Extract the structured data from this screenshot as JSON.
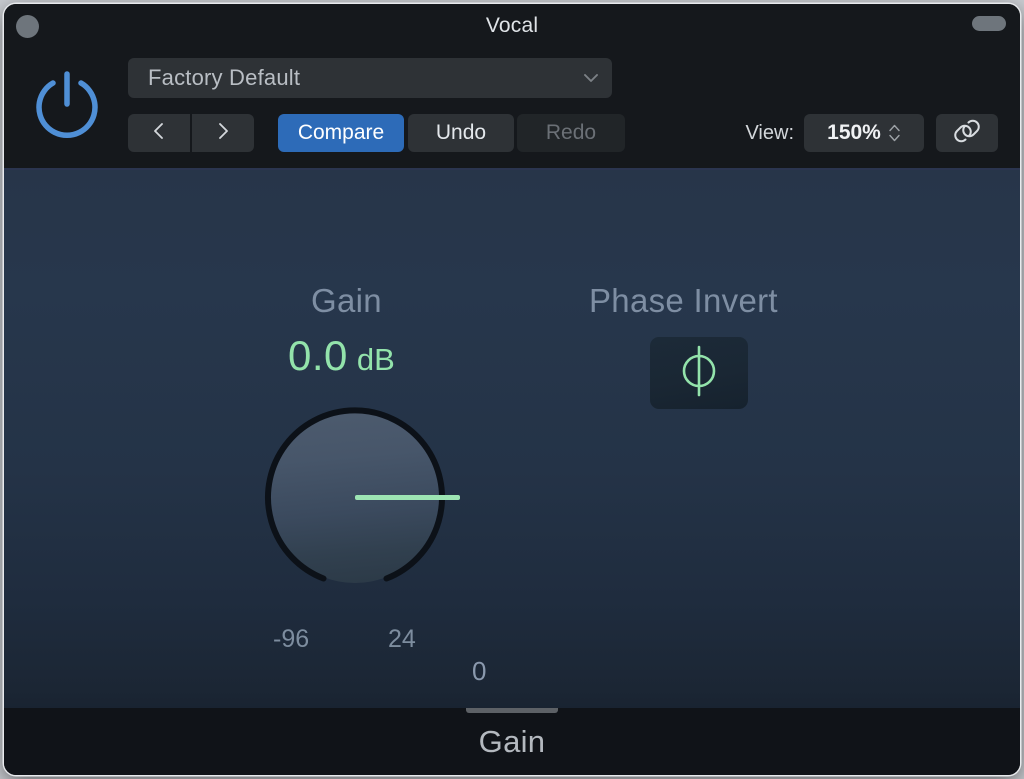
{
  "window": {
    "title": "Vocal",
    "close_icon": "close-circle-icon",
    "resize_icon": "resize-pill-icon"
  },
  "header": {
    "power_icon": "power-icon",
    "power_state": "on",
    "preset": {
      "value": "Factory Default",
      "chevron_icon": "chevron-down-icon"
    },
    "nav": {
      "prev_icon": "chevron-left-icon",
      "next_icon": "chevron-right-icon"
    },
    "compare_label": "Compare",
    "undo_label": "Undo",
    "redo_label": "Redo",
    "view_label": "View:",
    "zoom_value": "150%",
    "stepper_icon": "stepper-up-down-icon",
    "link_icon": "link-chain-icon"
  },
  "main": {
    "gain": {
      "label": "Gain",
      "value": "0.0",
      "unit": "dB",
      "knob_readout": "0",
      "range_min": "-96",
      "range_max": "24"
    },
    "phase": {
      "label": "Phase Invert",
      "button_icon": "phase-invert-phi-icon",
      "enabled": false
    }
  },
  "footer": {
    "title": "Gain",
    "grip_icon": "resize-grip-icon"
  },
  "colors": {
    "accent_blue": "#2d6bb8",
    "power_blue": "#4f8fd6",
    "value_green": "#93e3ab",
    "panel_top": "#273549",
    "panel_bottom": "#182230",
    "chrome_dark": "#15181c",
    "label_muted": "#7e8ea3"
  }
}
